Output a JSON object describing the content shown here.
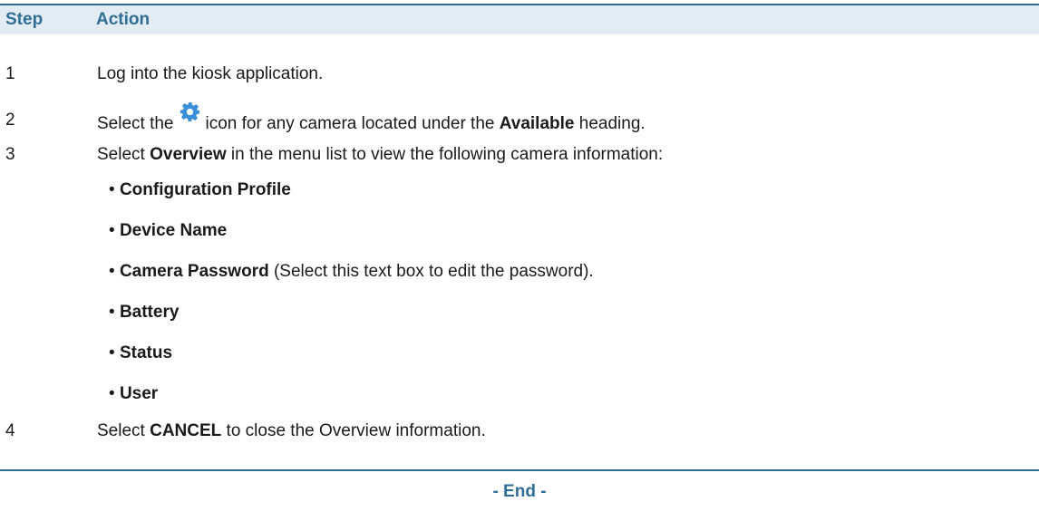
{
  "table": {
    "headers": {
      "step": "Step",
      "action": "Action"
    },
    "rows": [
      {
        "step": "1",
        "text": "Log into the kiosk application."
      },
      {
        "step": "2",
        "pre": "Select the",
        "icon": "gear-icon",
        "mid": "icon for any camera located under the",
        "bold": "Available",
        "post": "heading."
      },
      {
        "step": "3",
        "pre": "Select",
        "bold": "Overview",
        "post": "in the menu list to view the following camera information:"
      },
      {
        "step": "4",
        "pre": "Select",
        "bold": "CANCEL",
        "post": "to close the Overview information."
      }
    ],
    "bullets": [
      {
        "bold": "Configuration Profile",
        "rest": ""
      },
      {
        "bold": "Device Name",
        "rest": ""
      },
      {
        "bold": "Camera Password",
        "rest": "(Select this text box to edit the password)."
      },
      {
        "bold": "Battery",
        "rest": ""
      },
      {
        "bold": "Status",
        "rest": ""
      },
      {
        "bold": "User",
        "rest": ""
      }
    ],
    "bullet_char": "•"
  },
  "footer": {
    "end_label": "- End -"
  },
  "colors": {
    "accent": "#2f6f97",
    "header_bg": "#e4ecf3",
    "gear": "#3a8fd9"
  }
}
